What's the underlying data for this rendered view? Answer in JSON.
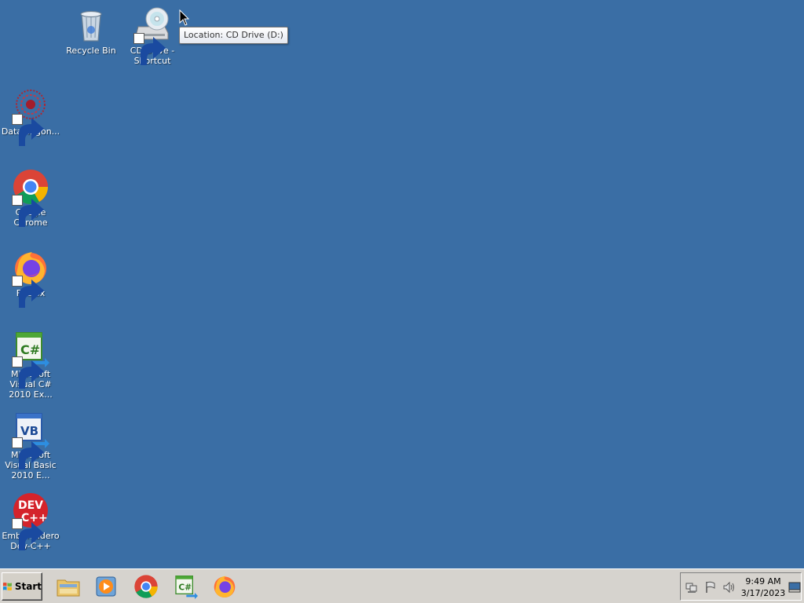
{
  "desktop": {
    "background_color": "#3a6ea5",
    "icons": [
      {
        "label": "Recycle Bin",
        "icon": "recycle-bin-icon"
      },
      {
        "label": "CD Drive - Shortcut",
        "icon": "cd-drive-icon"
      },
      {
        "label": "DataWagon...",
        "icon": "datawagon-icon"
      },
      {
        "label": "Google Chrome",
        "icon": "chrome-icon"
      },
      {
        "label": "Firefox",
        "icon": "firefox-icon"
      },
      {
        "label": "Microsoft Visual C# 2010 Ex...",
        "icon": "visual-csharp-icon"
      },
      {
        "label": "Microsoft Visual Basic 2010 E...",
        "icon": "visual-basic-icon"
      },
      {
        "label": "Embarcadero Dev-C++",
        "icon": "dev-cpp-icon"
      }
    ],
    "tooltip": "Location: CD Drive (D:)"
  },
  "taskbar": {
    "start_label": "Start",
    "pinned": [
      {
        "icon": "file-explorer-icon"
      },
      {
        "icon": "media-player-icon"
      },
      {
        "icon": "chrome-icon"
      },
      {
        "icon": "visual-csharp-icon"
      },
      {
        "icon": "firefox-icon"
      }
    ],
    "tray": {
      "icons": [
        "network-icon",
        "action-center-flag-icon",
        "volume-icon"
      ],
      "time": "9:49 AM",
      "date": "3/17/2023"
    }
  }
}
